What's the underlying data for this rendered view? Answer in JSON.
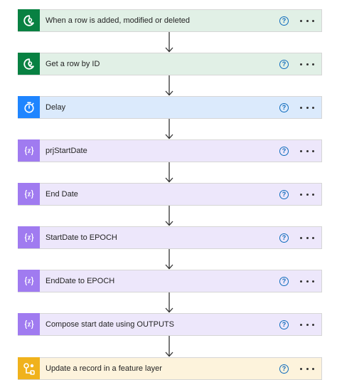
{
  "flow": {
    "steps": [
      {
        "label": "When a row is added, modified or deleted",
        "kind": "dataverse",
        "bg": "#e1f0e6",
        "icon_bg": "#088142",
        "icon": "dataverse-icon"
      },
      {
        "label": "Get a row by ID",
        "kind": "dataverse",
        "bg": "#e1f0e6",
        "icon_bg": "#088142",
        "icon": "dataverse-icon"
      },
      {
        "label": "Delay",
        "kind": "schedule",
        "bg": "#dbeafc",
        "icon_bg": "#1f85ff",
        "icon": "timer-icon"
      },
      {
        "label": "prjStartDate",
        "kind": "variable",
        "bg": "#ede7fb",
        "icon_bg": "#a07bf0",
        "icon": "variable-icon"
      },
      {
        "label": "End Date",
        "kind": "variable",
        "bg": "#ede7fb",
        "icon_bg": "#a07bf0",
        "icon": "variable-icon"
      },
      {
        "label": "StartDate to EPOCH",
        "kind": "variable",
        "bg": "#ede7fb",
        "icon_bg": "#a07bf0",
        "icon": "variable-icon"
      },
      {
        "label": "EndDate to EPOCH",
        "kind": "variable",
        "bg": "#ede7fb",
        "icon_bg": "#a07bf0",
        "icon": "variable-icon"
      },
      {
        "label": "Compose start date using OUTPUTS",
        "kind": "variable",
        "bg": "#ede7fb",
        "icon_bg": "#a07bf0",
        "icon": "variable-icon"
      },
      {
        "label": "Update a record in a feature layer",
        "kind": "arcgis",
        "bg": "#fdf3dc",
        "icon_bg": "#f0b21c",
        "icon": "arcgis-icon"
      }
    ],
    "help_glyph": "?",
    "help_icon": "help-circle-icon",
    "more_icon": "more-options-icon"
  }
}
